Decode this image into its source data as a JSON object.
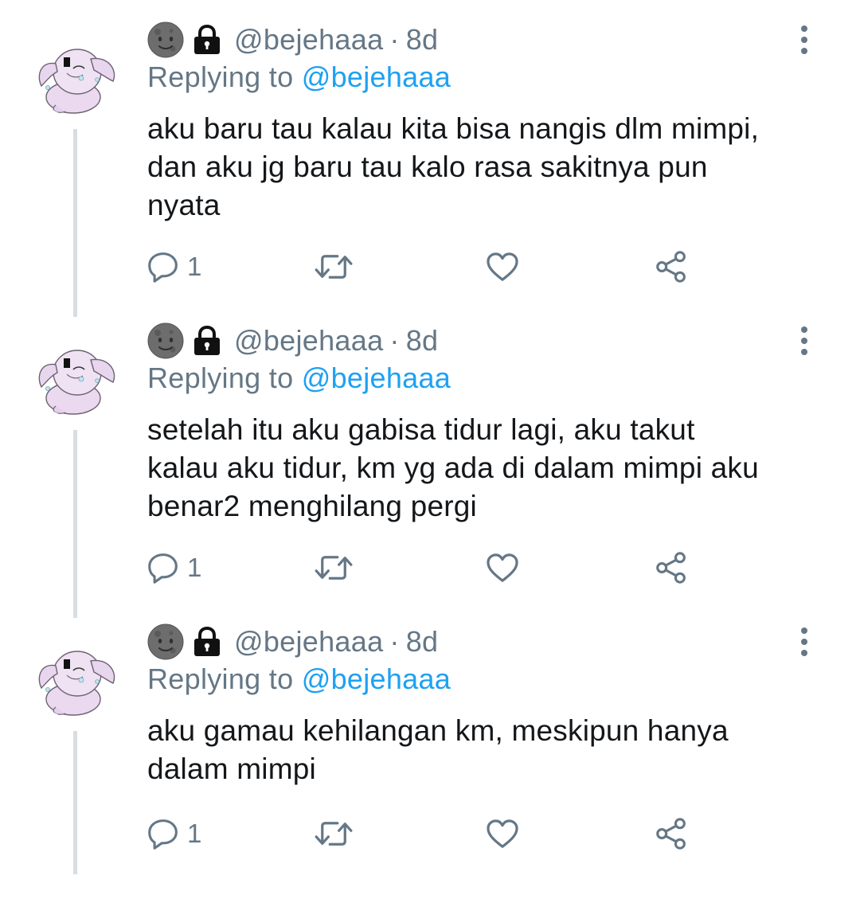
{
  "tweets": [
    {
      "handle": "@bejehaaa",
      "separator": "·",
      "time": "8d",
      "replying_prefix": "Replying to",
      "replying_to": "@bejehaaa",
      "lines": [
        "aku baru tau kalau kita bisa nangis dlm mimpi,",
        "dan aku jg baru tau kalo rasa sakitnya pun",
        "nyata"
      ],
      "reply_count": "1"
    },
    {
      "handle": "@bejehaaa",
      "separator": "·",
      "time": "8d",
      "replying_prefix": "Replying to",
      "replying_to": "@bejehaaa",
      "lines": [
        "setelah itu aku gabisa tidur lagi, aku takut",
        "kalau aku tidur, km yg ada di dalam mimpi aku",
        "benar2 menghilang pergi"
      ],
      "reply_count": "1"
    },
    {
      "handle": "@bejehaaa",
      "separator": "·",
      "time": "8d",
      "replying_prefix": "Replying to",
      "replying_to": "@bejehaaa",
      "lines": [
        "aku gamau kehilangan km, meskipun hanya",
        "dalam mimpi"
      ],
      "reply_count": "1"
    }
  ],
  "icons": {
    "name_emoji": "new-moon-face-icon",
    "protected": "lock-icon",
    "menu": "more-vertical-icon",
    "reply": "reply-icon",
    "retweet": "retweet-icon",
    "like": "heart-icon",
    "share": "share-icon"
  },
  "colors": {
    "text": "#14171a",
    "secondary": "#657786",
    "link": "#1da1f2",
    "thread_line": "#d7dde2"
  }
}
